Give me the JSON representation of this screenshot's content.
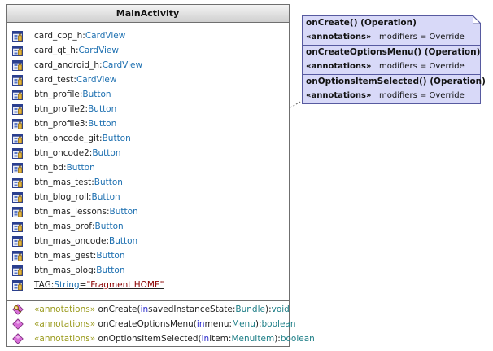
{
  "class": {
    "name": "MainActivity",
    "attributes": [
      {
        "name": "card_cpp_h",
        "sep": ":",
        "type": "CardView"
      },
      {
        "name": "card_qt_h",
        "sep": ":",
        "type": "CardView"
      },
      {
        "name": "card_android_h",
        "sep": ":",
        "type": "CardView"
      },
      {
        "name": "card_test",
        "sep": ":",
        "type": "CardView"
      },
      {
        "name": "btn_profile",
        "sep": ":",
        "type": "Button"
      },
      {
        "name": "btn_profile2",
        "sep": ":",
        "type": "Button"
      },
      {
        "name": "btn_profile3",
        "sep": ":",
        "type": "Button"
      },
      {
        "name": "btn_oncode_git",
        "sep": ":",
        "type": "Button"
      },
      {
        "name": "btn_oncode2",
        "sep": ":",
        "type": "Button"
      },
      {
        "name": "btn_bd",
        "sep": ":",
        "type": "Button"
      },
      {
        "name": "btn_mas_test",
        "sep": ":",
        "type": "Button"
      },
      {
        "name": "btn_blog_roll",
        "sep": ":",
        "type": "Button"
      },
      {
        "name": "btn_mas_lessons",
        "sep": ":",
        "type": "Button"
      },
      {
        "name": "btn_mas_prof",
        "sep": ":",
        "type": "Button"
      },
      {
        "name": "btn_mas_oncode",
        "sep": ":",
        "type": "Button"
      },
      {
        "name": "btn_mas_gest",
        "sep": ":",
        "type": "Button"
      },
      {
        "name": "btn_mas_blog",
        "sep": ":",
        "type": "Button"
      }
    ],
    "tag": {
      "name": "TAG",
      "sep": ":",
      "type": "String",
      "eq": "=",
      "value": "\"Fragment HOME\""
    },
    "operations": [
      {
        "stereotype": "«annotations»",
        "name": "onCreate(",
        "kw": "in",
        "param": " savedInstanceState:",
        "ptype": "Bundle",
        "close": "):",
        "ret": "void"
      },
      {
        "stereotype": "«annotations»",
        "name": "onCreateOptionsMenu(",
        "kw": "in",
        "param": " menu:",
        "ptype": "Menu",
        "close": "):",
        "ret": "boolean"
      },
      {
        "stereotype": "«annotations»",
        "name": "onOptionsItemSelected(",
        "kw": "in",
        "param": " item:",
        "ptype": "MenuItem",
        "close": "):",
        "ret": "boolean"
      }
    ]
  },
  "note": {
    "entries": [
      {
        "title": "onCreate() (Operation)",
        "ann_label": "«annotations»",
        "ann_value": "modifiers = Override"
      },
      {
        "title": "onCreateOptionsMenu() (Operation)",
        "ann_label": "«annotations»",
        "ann_value": "modifiers = Override"
      },
      {
        "title": "onOptionsItemSelected() (Operation)",
        "ann_label": "«annotations»",
        "ann_value": "modifiers = Override"
      }
    ]
  },
  "colors": {
    "note_fill": "#d8d9f8",
    "note_border": "#575aa0",
    "type_text": "#1c6fb0",
    "stereotype_text": "#9a9a1c",
    "string_value": "#8b0000",
    "operation_icon": "#d86fd8"
  },
  "icons": {
    "attribute": "private-field-icon",
    "protected_operation": "protected-operation-key-icon",
    "operation": "public-operation-diamond-icon"
  }
}
